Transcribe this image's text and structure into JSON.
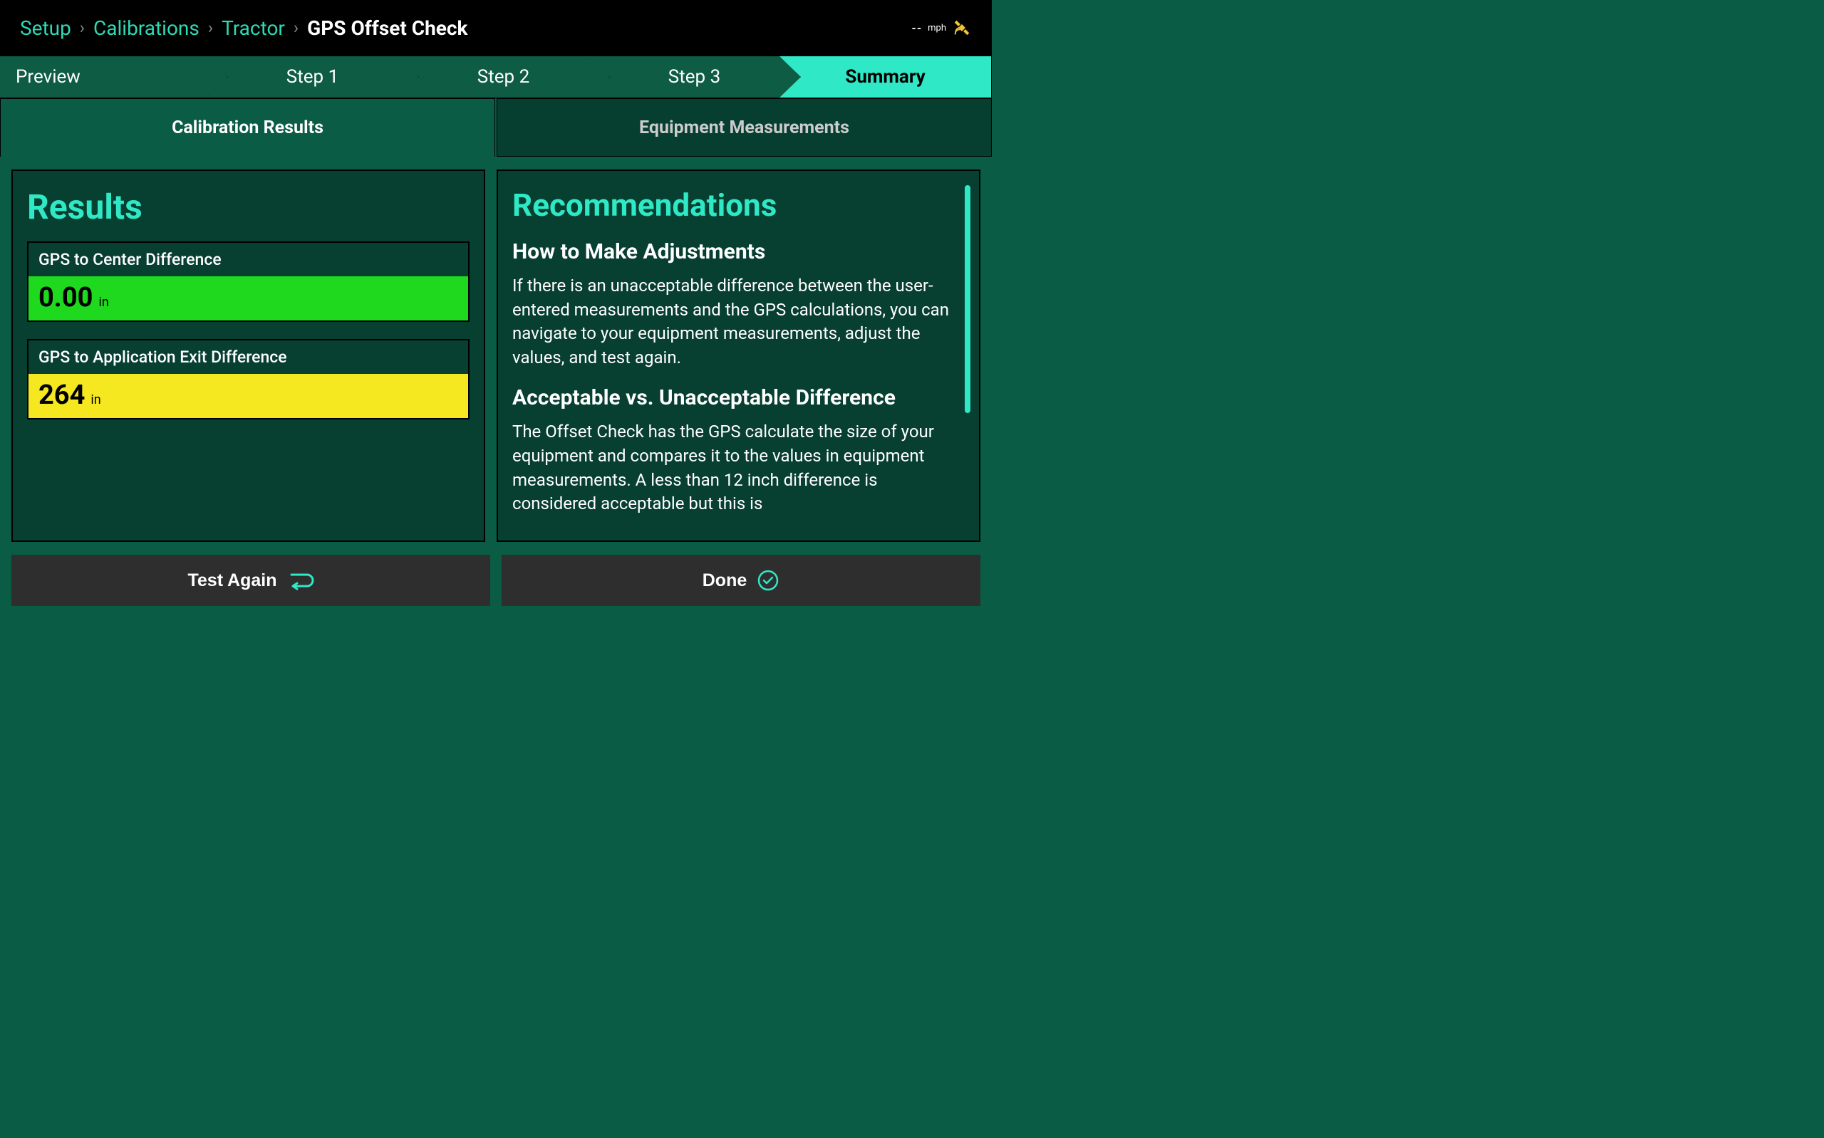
{
  "breadcrumb": {
    "items": [
      "Setup",
      "Calibrations",
      "Tractor"
    ],
    "current": "GPS Offset Check"
  },
  "status": {
    "speed_value": "--",
    "speed_unit": "mph"
  },
  "steps": {
    "items": [
      "Preview",
      "Step 1",
      "Step 2",
      "Step 3",
      "Summary"
    ]
  },
  "subtabs": {
    "items": [
      "Calibration Results",
      "Equipment Measurements"
    ]
  },
  "results": {
    "title": "Results",
    "items": [
      {
        "label": "GPS to Center Difference",
        "value": "0.00",
        "unit": "in",
        "color": "green"
      },
      {
        "label": "GPS to Application Exit Difference",
        "value": "264",
        "unit": "in",
        "color": "yellow"
      }
    ]
  },
  "recommendations": {
    "title": "Recommendations",
    "sections": [
      {
        "heading": "How to Make Adjustments",
        "body": "If there is an unacceptable difference between the user-entered measurements and the GPS calculations, you can navigate to your equipment measurements, adjust the values, and test again."
      },
      {
        "heading": "Acceptable vs. Unacceptable Difference",
        "body": "The Offset Check has the GPS calculate the size of your equipment and compares it to the values in equipment measurements. A less than 12 inch difference is considered acceptable but this is"
      }
    ]
  },
  "buttons": {
    "test_again": "Test Again",
    "done": "Done"
  }
}
